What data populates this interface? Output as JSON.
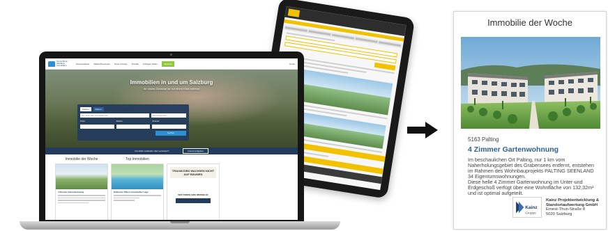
{
  "laptop_site": {
    "logo_text": "home.ibk.at Salzburg Immobilien",
    "nav": [
      "Hausverkäufer",
      "Makler/Developer",
      "Neue Anzeige",
      "Kontakt",
      "Anfragen bilden",
      "Merkliste"
    ],
    "nav_right": "Konto",
    "hero_title": "Immobilien in und um Salzburg",
    "hero_subtitle": "Ihr neues Zuhause ist nur einen Klick entfernt",
    "search_tabs": [
      "Kaufen",
      "Mieten"
    ],
    "search_placeholder": "Ort, PLZ oder Immobilien-ID",
    "search_select": "Alle Kategorien",
    "search_labels": [
      "Preis",
      "Fläche",
      "Zimmer"
    ],
    "search_button": "Suchen",
    "strip_text": "Immobilie verkaufen oder vermieten?",
    "strip_button": "Inserat aufgeben",
    "col_titles": [
      "Immobilie der Woche",
      "Top Immobilien"
    ],
    "card1_head": "4 Zimmer Gartenwohnung",
    "card2_head": "Exklusive Villa in traumhafter Lage",
    "ad_title": "TRAUMJOBS WACHSEN NICHT AUF BÄUMEN",
    "ad_question": "WIR FINDEN IHRE IMMOBILIE!"
  },
  "teaser": {
    "title": "Immobilie der Woche",
    "zip": "5163 Palting",
    "headline": "4 Zimmer Gartenwohnung",
    "description_lines": [
      "Im beschaulichen Ort Palting, nur 1 km vom",
      "Naherholungsgebiet des Grabensees entfernt, entstehen",
      "im Rahmen des Wohnbauprojekts PALTING SEENLAND",
      "34 Eigentumswohnungen.",
      "Diese helle 4 Zimmer Gartenwohnung im Unter-und",
      "Erdgeschoß verfügt über eine Wohnfläche von 132,32m²",
      "und ist optimal aufgeteilt."
    ],
    "logo_word": "Kainz",
    "logo_sub": "Gruppe",
    "company_lines": [
      "Kainz Projektentwicklung &",
      "Standortaufwertung GmbH"
    ],
    "address_lines": [
      "Ernest-Thun-Straße 8",
      "5020 Salzburg"
    ]
  },
  "colors": {
    "brand_blue": "#2f5f93",
    "navy": "#233b5d",
    "accent_green": "#8fc740",
    "tablet_yellow": "#f2c200"
  },
  "icons": {
    "arrow": "arrow-right-icon"
  }
}
